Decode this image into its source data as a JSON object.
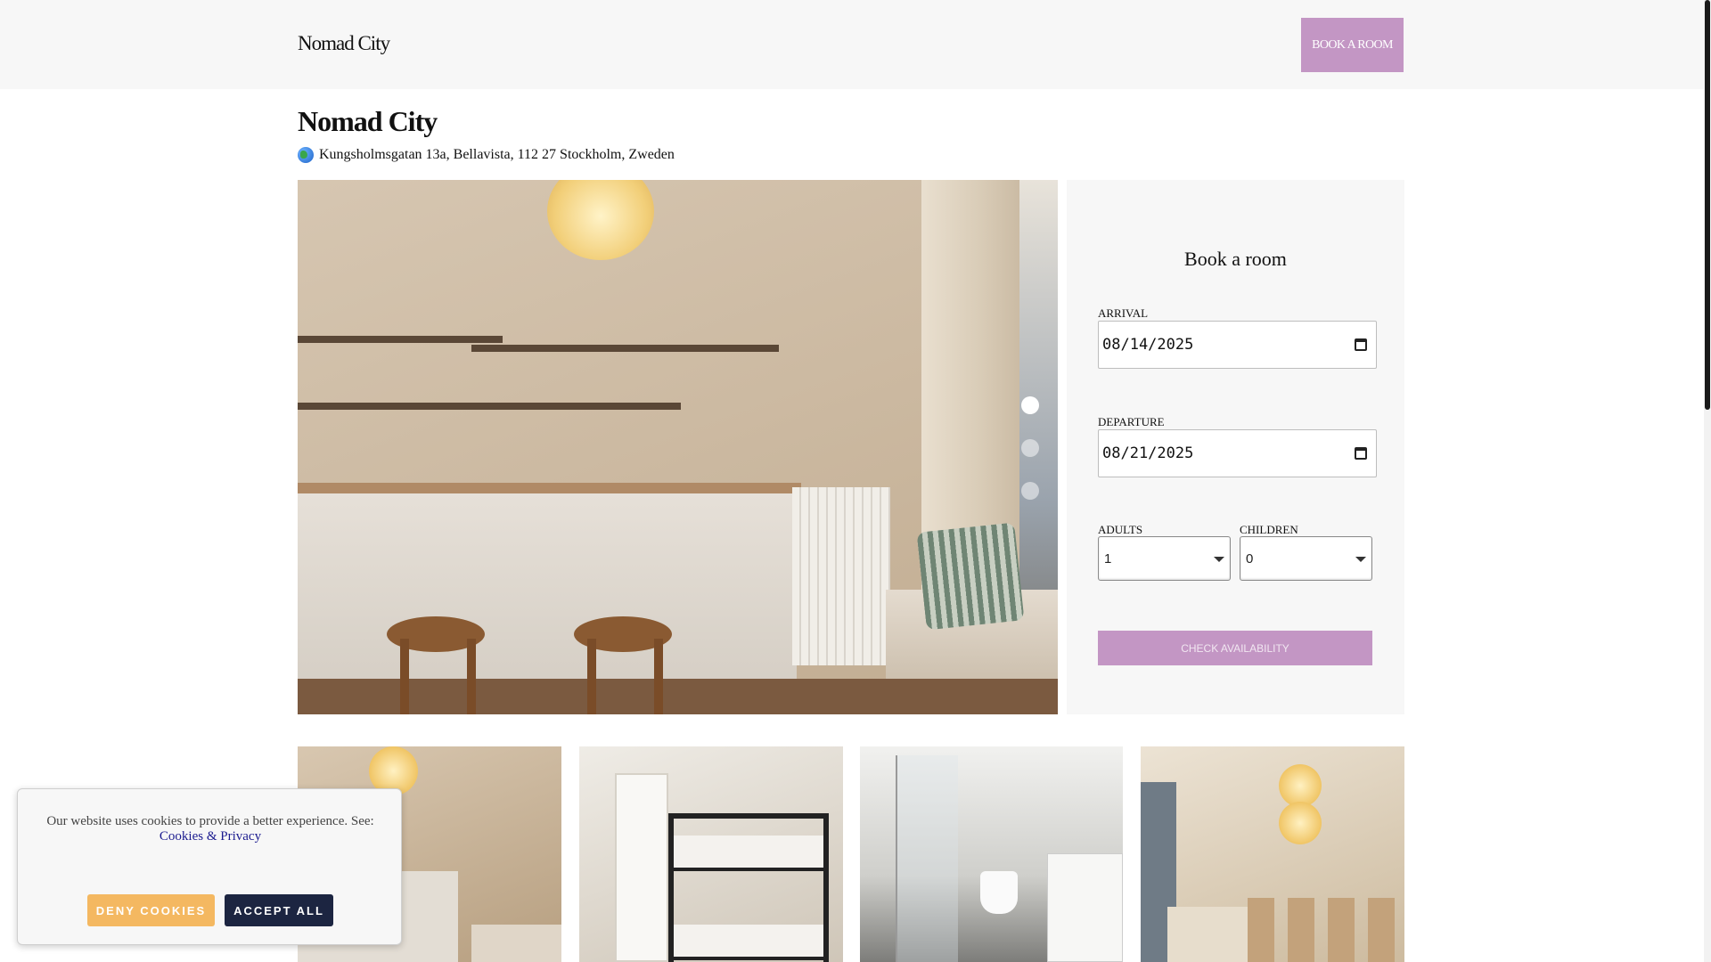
{
  "header": {
    "brand": "Nomad City",
    "book_button": "BOOK A ROOM"
  },
  "hotel": {
    "name": "Nomad City",
    "address_icon": "globe-icon",
    "address": "Kungsholmsgatan 13a, Bellavista, 112 27 Stockholm, Zweden"
  },
  "gallery": {
    "slide_count": 3,
    "active_slide": 1
  },
  "booking": {
    "title": "Book a room",
    "arrival_label": "ARRIVAL",
    "arrival_value": "08/14/2025",
    "departure_label": "DEPARTURE",
    "departure_value": "08/21/2025",
    "adults_label": "ADULTS",
    "adults_value": "1",
    "children_label": "CHILDREN",
    "children_value": "0",
    "check_button": "CHECK AVAILABILITY",
    "accent_color": "#c396c4"
  },
  "cookie_banner": {
    "text": "Our website uses cookies to provide a better experience. See:",
    "link": "Cookies & Privacy",
    "deny_button": "DENY COOKIES",
    "accept_button": "ACCEPT ALL",
    "deny_color": "#f4b861",
    "accept_color": "#1c2541"
  }
}
